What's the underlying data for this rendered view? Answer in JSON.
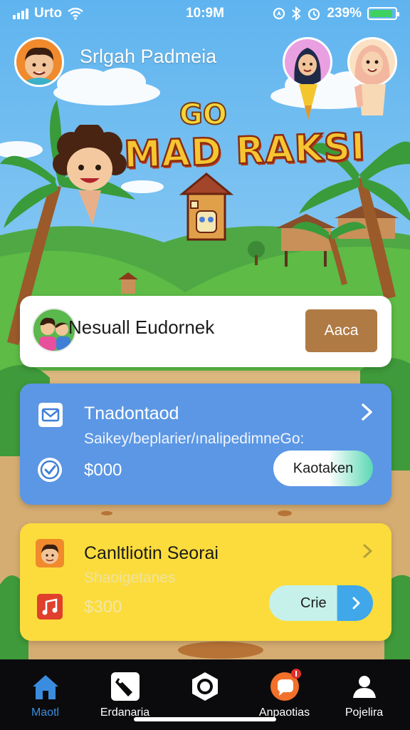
{
  "status_bar": {
    "carrier": "Urto",
    "time": "10:9M",
    "battery": "239%",
    "battery_level": 0.9,
    "icons": [
      "signal-icon",
      "wifi-icon",
      "location-icon",
      "bluetooth-icon",
      "alarm-icon",
      "battery-icon"
    ]
  },
  "header": {
    "title": "Srlgah Padmeia"
  },
  "logo": {
    "badge": "GO",
    "title": "MAD RAKSI"
  },
  "profile_card": {
    "name": "Nesuall Eudornek",
    "button_label": "Aaca"
  },
  "task_card": {
    "title": "Tnadontaod",
    "subtitle": "Saikey/beplarier/ınalipedimneGo:",
    "amount": "$000",
    "button_label": "Kaotaken",
    "icons": [
      "mail-icon",
      "check-circle-icon",
      "chevron-right-icon"
    ]
  },
  "challenge_card": {
    "title": "Canltliotin Seorai",
    "subtitle": "Shaoigetanes",
    "amount": "$300",
    "button_label": "Crie",
    "icons": [
      "avatar-icon",
      "music-icon",
      "chevron-right-icon"
    ]
  },
  "nav": {
    "items": [
      {
        "label": "Maotl",
        "icon": "home-icon",
        "active": true
      },
      {
        "label": "Erdanaria",
        "icon": "tag-icon",
        "active": false
      },
      {
        "label": "",
        "icon": "hexagon-icon",
        "active": false
      },
      {
        "label": "Anpaotias",
        "icon": "bubble-icon",
        "active": false
      },
      {
        "label": "Pojelira",
        "icon": "person-icon",
        "active": false
      }
    ]
  },
  "colors": {
    "accent_blue": "#5b97e4",
    "accent_yellow": "#fbdc3c",
    "brown_button": "#b07a44",
    "nav_active": "#3a8dde",
    "nav_background": "#0b0b0d"
  }
}
